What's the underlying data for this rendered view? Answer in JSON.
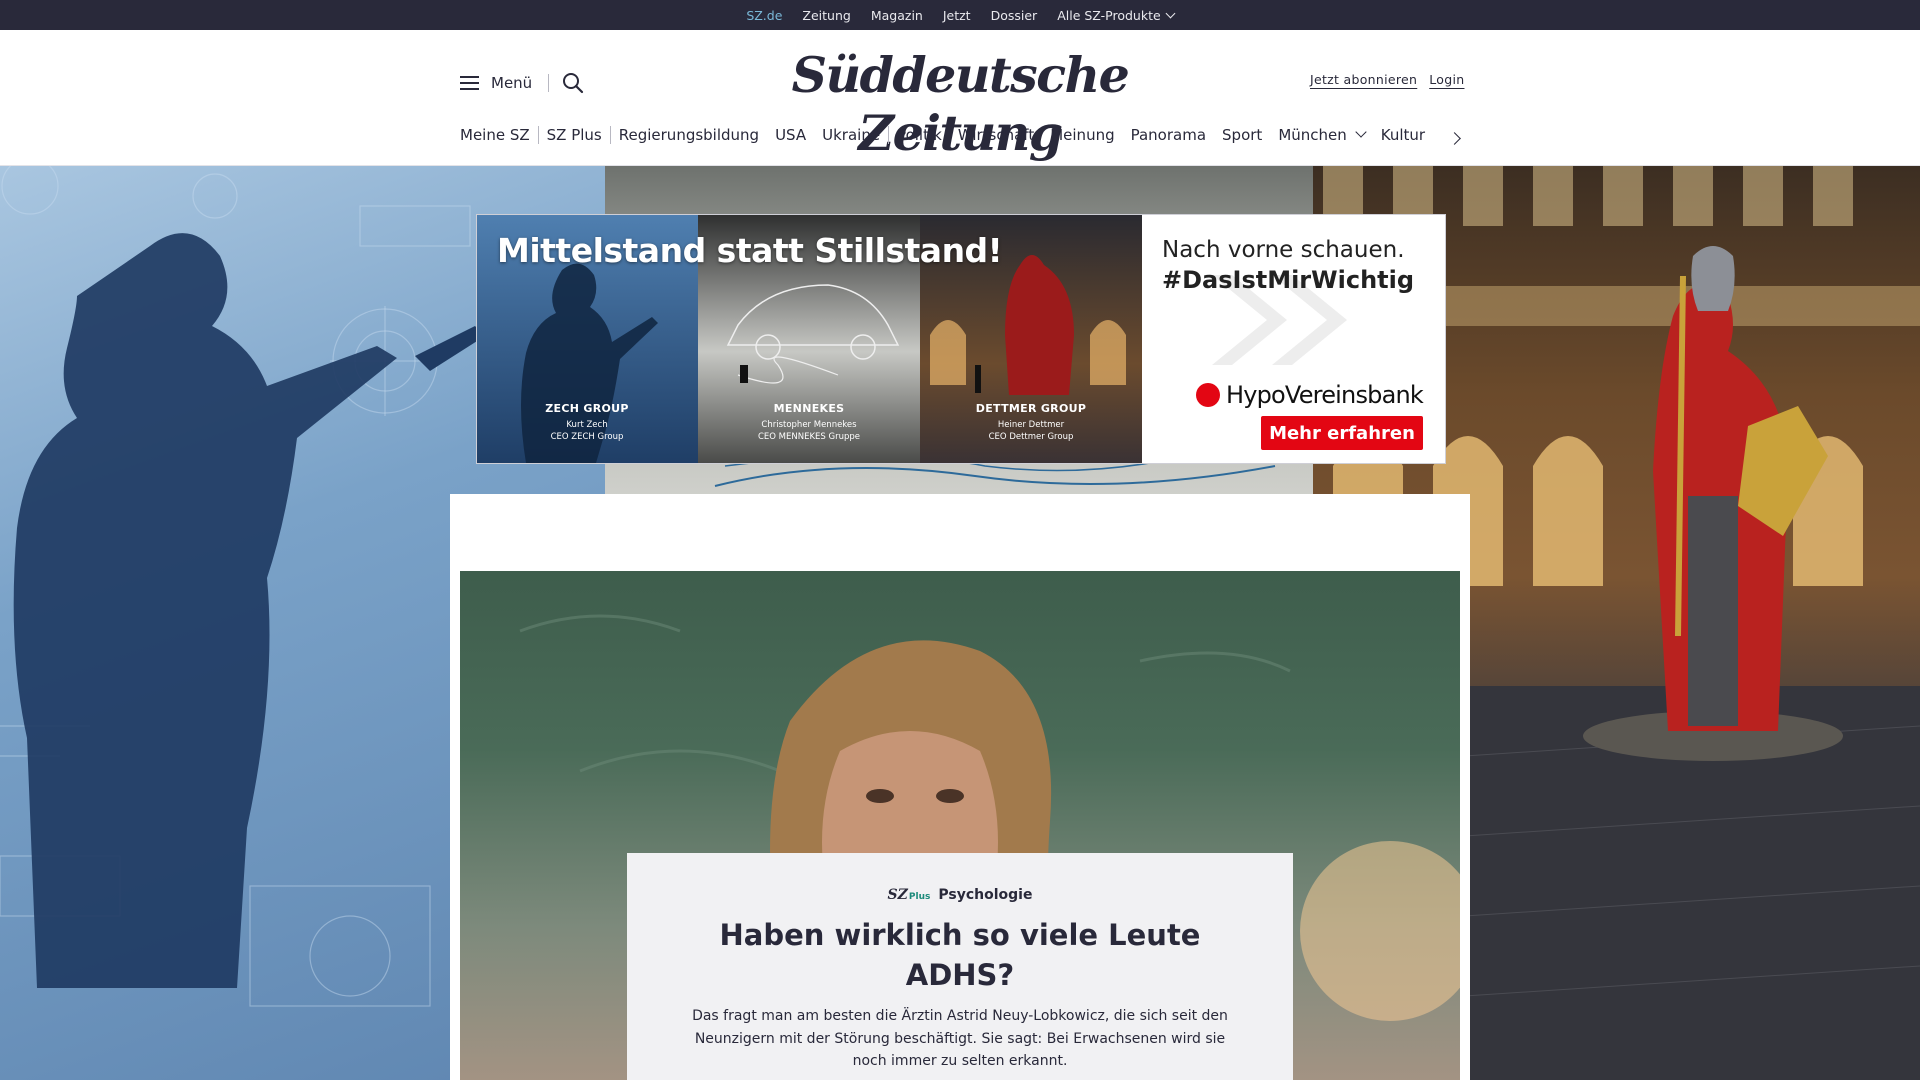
{
  "topbar": {
    "links": [
      "SZ.de",
      "Zeitung",
      "Magazin",
      "Jetzt",
      "Dossier",
      "Alle SZ-Produkte"
    ]
  },
  "header": {
    "menu_label": "Menü",
    "logo": "Süddeutsche Zeitung",
    "subscribe": "Jetzt abonnieren",
    "login": "Login"
  },
  "nav": {
    "items": [
      "Meine SZ",
      "SZ Plus",
      "Regierungsbildung",
      "USA",
      "Ukraine",
      "Politik",
      "Wirtschaft",
      "Meinung",
      "Panorama",
      "Sport",
      "München",
      "Kultur"
    ]
  },
  "ad": {
    "headline": "Mittelstand statt Stillstand!",
    "panels": [
      {
        "company": "ZECH GROUP",
        "person": "Kurt Zech",
        "role": "CEO ZECH Group"
      },
      {
        "company": "MENNEKES",
        "person": "Christopher Mennekes",
        "role": "CEO MENNEKES Gruppe"
      },
      {
        "company": "DETTMER GROUP",
        "person": "Heiner Dettmer",
        "role": "CEO Dettmer Group"
      }
    ],
    "slogan": "Nach vorne schauen.",
    "hashtag": "#DasIstMirWichtig",
    "brand": "HypoVereinsbank",
    "cta": "Mehr erfahren",
    "brand_color": "#e30613"
  },
  "teaser": {
    "badge": "SZ",
    "badge_plus": "Plus",
    "category": "Psychologie",
    "title": "Haben wirklich so viele Leute ADHS?",
    "text": "Das fragt man am besten die Ärztin Astrid Neuy-Lobkowicz, die sich seit den Neunzigern mit der Störung beschäftigt. Sie sagt: Bei Erwachsenen wird sie noch immer zu selten erkannt."
  },
  "colors": {
    "dark": "#29293a",
    "accent_link": "#7ab8d8",
    "teaser_bg": "#f1f1f3"
  }
}
